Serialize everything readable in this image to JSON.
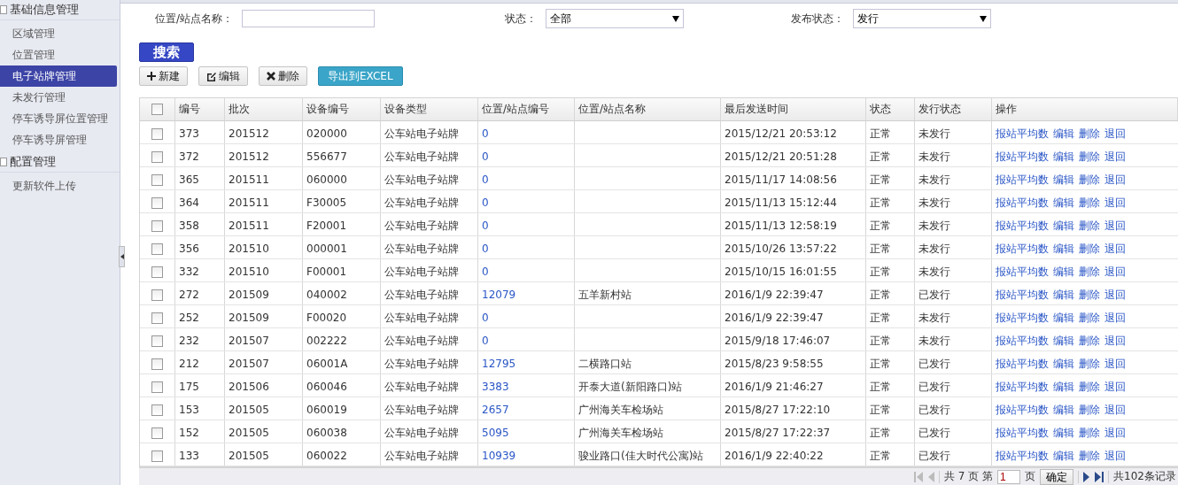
{
  "sidebar": {
    "groups": [
      {
        "title": "基础信息管理",
        "items": [
          {
            "label": "区域管理",
            "selected": false
          },
          {
            "label": "位置管理",
            "selected": false
          },
          {
            "label": "电子站牌管理",
            "selected": true
          },
          {
            "label": "未发行管理",
            "selected": false
          },
          {
            "label": "停车诱导屏位置管理",
            "selected": false
          },
          {
            "label": "停车诱导屏管理",
            "selected": false
          }
        ]
      },
      {
        "title": "配置管理",
        "items": [
          {
            "label": "更新软件上传",
            "selected": false
          }
        ]
      }
    ]
  },
  "filters": [
    {
      "kind": "text",
      "label": "位置/站点名称："
    },
    {
      "kind": "select",
      "label": "状态：",
      "value": "全部"
    },
    {
      "kind": "select",
      "label": "发布状态：",
      "value": "发行"
    }
  ],
  "search_button": "搜索",
  "toolbar": [
    {
      "kind": "plus",
      "label": "新建"
    },
    {
      "kind": "edit",
      "label": "编辑"
    },
    {
      "kind": "delete",
      "label": "删除"
    },
    {
      "kind": "export",
      "label": "导出到EXCEL"
    }
  ],
  "table": {
    "header_checked": false,
    "columns": [
      "编号",
      "批次",
      "设备编号",
      "设备类型",
      "位置/站点编号",
      "位置/站点名称",
      "最后发送时间",
      "状态",
      "发行状态",
      "操作"
    ],
    "rows": [
      {
        "checked": false,
        "cells": [
          "373",
          "201512",
          "020000",
          "公车站电子站牌",
          "0",
          null,
          "2015/12/21 20:53:12",
          "正常",
          "未发行"
        ],
        "actions": [
          "报站平均数",
          "编辑",
          "删除",
          "退回"
        ]
      },
      {
        "checked": false,
        "cells": [
          "372",
          "201512",
          "556677",
          "公车站电子站牌",
          "0",
          null,
          "2015/12/21 20:51:28",
          "正常",
          "未发行"
        ],
        "actions": [
          "报站平均数",
          "编辑",
          "删除",
          "退回"
        ]
      },
      {
        "checked": false,
        "cells": [
          "365",
          "201511",
          "060000",
          "公车站电子站牌",
          "0",
          null,
          "2015/11/17 14:08:56",
          "正常",
          "未发行"
        ],
        "actions": [
          "报站平均数",
          "编辑",
          "删除",
          "退回"
        ]
      },
      {
        "checked": false,
        "cells": [
          "364",
          "201511",
          "F30005",
          "公车站电子站牌",
          "0",
          null,
          "2015/11/13 15:12:44",
          "正常",
          "未发行"
        ],
        "actions": [
          "报站平均数",
          "编辑",
          "删除",
          "退回"
        ]
      },
      {
        "checked": false,
        "cells": [
          "358",
          "201511",
          "F20001",
          "公车站电子站牌",
          "0",
          null,
          "2015/11/13 12:58:19",
          "正常",
          "未发行"
        ],
        "actions": [
          "报站平均数",
          "编辑",
          "删除",
          "退回"
        ]
      },
      {
        "checked": false,
        "cells": [
          "356",
          "201510",
          "000001",
          "公车站电子站牌",
          "0",
          null,
          "2015/10/26 13:57:22",
          "正常",
          "未发行"
        ],
        "actions": [
          "报站平均数",
          "编辑",
          "删除",
          "退回"
        ]
      },
      {
        "checked": false,
        "cells": [
          "332",
          "201510",
          "F00001",
          "公车站电子站牌",
          "0",
          null,
          "2015/10/15 16:01:55",
          "正常",
          "未发行"
        ],
        "actions": [
          "报站平均数",
          "编辑",
          "删除",
          "退回"
        ]
      },
      {
        "checked": false,
        "cells": [
          "272",
          "201509",
          "040002",
          "公车站电子站牌",
          "12079",
          "五羊新村站",
          "2016/1/9 22:39:47",
          "正常",
          "已发行"
        ],
        "actions": [
          "报站平均数",
          "编辑",
          "删除",
          "退回"
        ]
      },
      {
        "checked": false,
        "cells": [
          "252",
          "201509",
          "F00020",
          "公车站电子站牌",
          "0",
          null,
          "2016/1/9 22:39:47",
          "正常",
          "未发行"
        ],
        "actions": [
          "报站平均数",
          "编辑",
          "删除",
          "退回"
        ]
      },
      {
        "checked": false,
        "cells": [
          "232",
          "201507",
          "002222",
          "公车站电子站牌",
          "0",
          null,
          "2015/9/18 17:46:07",
          "正常",
          "未发行"
        ],
        "actions": [
          "报站平均数",
          "编辑",
          "删除",
          "退回"
        ]
      },
      {
        "checked": false,
        "cells": [
          "212",
          "201507",
          "06001A",
          "公车站电子站牌",
          "12795",
          "二横路口站",
          "2015/8/23 9:58:55",
          "正常",
          "已发行"
        ],
        "actions": [
          "报站平均数",
          "编辑",
          "删除",
          "退回"
        ]
      },
      {
        "checked": false,
        "cells": [
          "175",
          "201506",
          "060046",
          "公车站电子站牌",
          "3383",
          "开泰大道(新阳路口)站",
          "2016/1/9 21:46:27",
          "正常",
          "已发行"
        ],
        "actions": [
          "报站平均数",
          "编辑",
          "删除",
          "退回"
        ]
      },
      {
        "checked": false,
        "cells": [
          "153",
          "201505",
          "060019",
          "公车站电子站牌",
          "2657",
          "广州海关车检场站",
          "2015/8/27 17:22:10",
          "正常",
          "已发行"
        ],
        "actions": [
          "报站平均数",
          "编辑",
          "删除",
          "退回"
        ]
      },
      {
        "checked": false,
        "cells": [
          "152",
          "201505",
          "060038",
          "公车站电子站牌",
          "5095",
          "广州海关车检场站",
          "2015/8/27 17:22:37",
          "正常",
          "已发行"
        ],
        "actions": [
          "报站平均数",
          "编辑",
          "删除",
          "退回"
        ]
      },
      {
        "checked": false,
        "cells": [
          "133",
          "201505",
          "060022",
          "公车站电子站牌",
          "10939",
          "骏业路口(佳大时代公寓)站",
          "2016/1/9 22:40:22",
          "正常",
          "已发行"
        ],
        "actions": [
          "报站平均数",
          "编辑",
          "删除",
          "退回"
        ]
      }
    ]
  },
  "pager": {
    "pages_text": "共 7 页 第",
    "page": "1",
    "page_suffix": "页",
    "go": "确定",
    "total": "共102条记录"
  }
}
